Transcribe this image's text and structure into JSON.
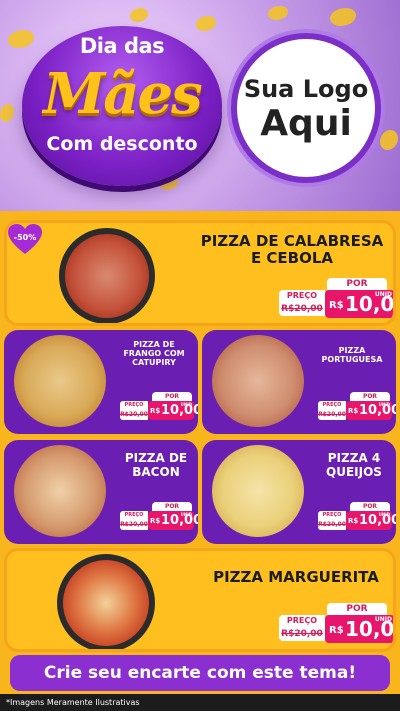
{
  "hero": {
    "badge_line1": "Dia das",
    "badge_line2": "Mães",
    "badge_line3": "Com desconto",
    "logo_line1": "Sua Logo",
    "logo_line2": "Aqui"
  },
  "discount_tag": "-50%",
  "labels": {
    "por": "POR",
    "preco": "PREÇO",
    "unid": "UNID",
    "currency": "R$"
  },
  "products": [
    {
      "name_line1": "PIZZA DE CALABRESA",
      "name_line2": "E CEBOLA",
      "old_price": "R$20,00",
      "new_price": "10,00"
    },
    {
      "name_line1": "PIZZA DE",
      "name_line2": "FRANGO COM",
      "name_line3": "CATUPIRY",
      "old_price": "R$20,00",
      "new_price": "10,00"
    },
    {
      "name_line1": "PIZZA",
      "name_line2": "PORTUGUESA",
      "old_price": "R$20,00",
      "new_price": "10,00"
    },
    {
      "name_line1": "PIZZA DE",
      "name_line2": "BACON",
      "old_price": "R$20,00",
      "new_price": "10,00"
    },
    {
      "name_line1": "PIZZA 4",
      "name_line2": "QUEIJOS",
      "old_price": "R$20,00",
      "new_price": "10,00"
    },
    {
      "name_line1": "PIZZA MARGUERITA",
      "old_price": "R$20,00",
      "new_price": "10,00"
    }
  ],
  "banner": "Crie seu encarte com este tema!",
  "footer": "*Imagens Meramente Ilustrativas",
  "colors": {
    "accent_purple": "#6a1fb2",
    "accent_yellow": "#ffc01f",
    "price_pink": "#e7166b"
  }
}
